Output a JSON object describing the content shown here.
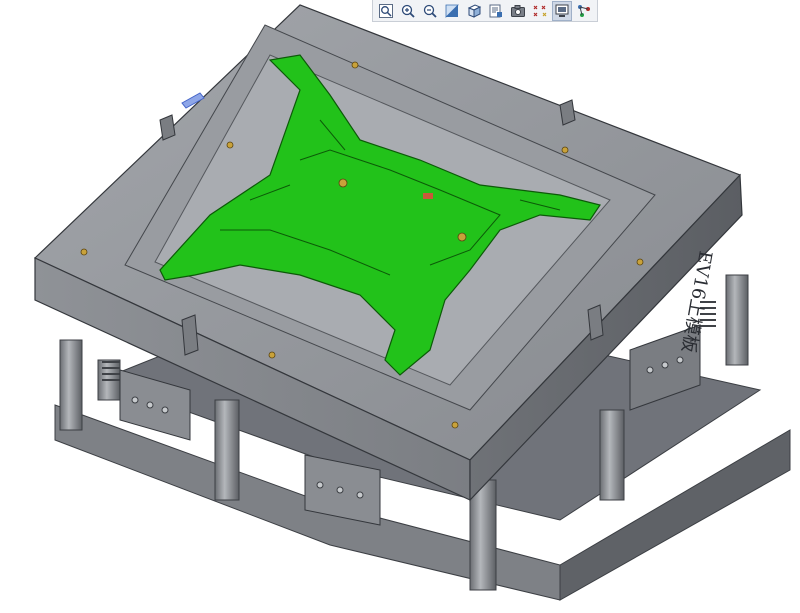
{
  "toolbar": {
    "buttons": [
      {
        "name": "zoom-to-fit",
        "icon": "zoom-fit-icon"
      },
      {
        "name": "zoom-in",
        "icon": "zoom-in-icon"
      },
      {
        "name": "zoom-out",
        "icon": "zoom-out-icon"
      },
      {
        "name": "repaint",
        "icon": "repaint-icon"
      },
      {
        "name": "shading",
        "icon": "shaded-cube-icon"
      },
      {
        "name": "saved-views",
        "icon": "saved-views-icon"
      },
      {
        "name": "view-manager",
        "icon": "camera-icon"
      },
      {
        "name": "datum-points",
        "icon": "datum-points-icon"
      },
      {
        "name": "display-style",
        "icon": "display-style-icon"
      },
      {
        "name": "spin-center",
        "icon": "spin-center-icon"
      }
    ]
  },
  "model": {
    "mold_text": "EV16上模板",
    "part_color": "#22c21a",
    "steel_color": "#8e9196",
    "steel_dark": "#5e6166",
    "steel_light": "#b7babe"
  }
}
